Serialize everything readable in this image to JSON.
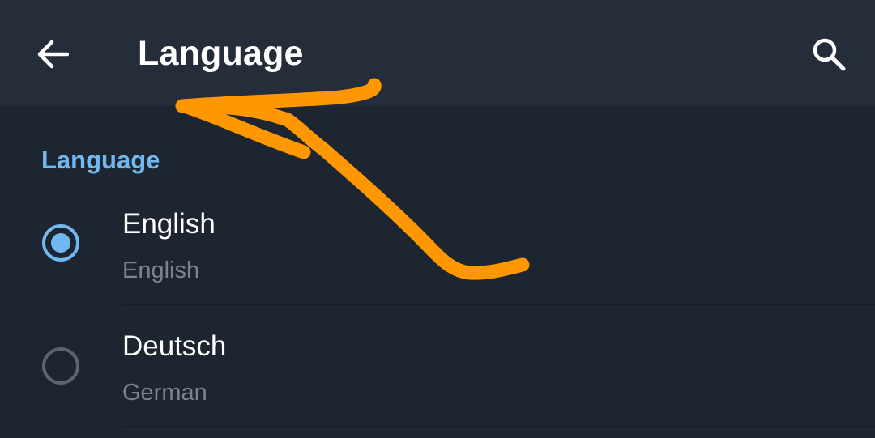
{
  "appbar": {
    "back_icon": "arrow-left-icon",
    "title": "Language",
    "search_icon": "search-icon"
  },
  "section": {
    "header": "Language"
  },
  "languages": [
    {
      "name": "English",
      "subtitle": "English",
      "selected": true
    },
    {
      "name": "Deutsch",
      "subtitle": "German",
      "selected": false
    }
  ],
  "colors": {
    "appbar_bg": "#252d3a",
    "page_bg": "#1d2530",
    "accent": "#71b8ee",
    "annotation": "#ff9800"
  }
}
